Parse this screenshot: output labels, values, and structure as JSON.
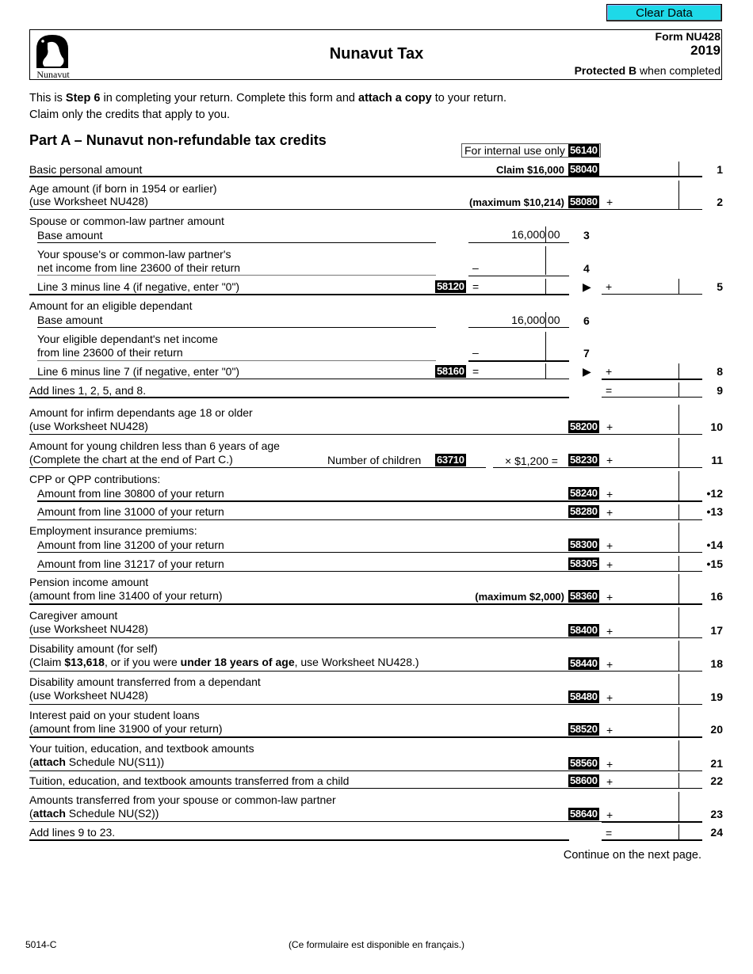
{
  "toolbar": {
    "clear_label": "Clear Data",
    "button_color": "#1ed9e8"
  },
  "header": {
    "logo_text": "Nunavut",
    "title": "Nunavut Tax",
    "form_id": "Form NU428",
    "year": "2019",
    "protected_bold": "Protected B",
    "protected_rest": " when completed"
  },
  "intro": {
    "line1": {
      "a": "This is ",
      "b": "Step 6",
      "c": " in completing your return. Complete this form and ",
      "d": "attach a copy",
      "e": " to your return."
    },
    "line2": "Claim only the credits that apply to you."
  },
  "part_a": {
    "title": "Part A – Nunavut non-refundable tax credits",
    "internal_use_label": "For internal use only",
    "internal_use_code": "56140"
  },
  "lines": {
    "l1": {
      "label": "Basic personal amount",
      "note": "Claim $16,000",
      "code": "58040",
      "num": "1"
    },
    "l2": {
      "label1": "Age amount (if born in 1954 or earlier)",
      "label2": "(use Worksheet NU428)",
      "note": "(maximum $10,214)",
      "code": "58080",
      "op": "+",
      "num": "2"
    },
    "spouse_heading": "Spouse or common-law partner amount",
    "l3": {
      "label": "Base amount",
      "value_dollars": "16,000",
      "value_cents": "00",
      "num": "3"
    },
    "l4": {
      "label1": "Your spouse's or common-law partner's",
      "label2": "net income from line 23600 of their return",
      "op": "–",
      "num": "4"
    },
    "l5": {
      "label": "Line 3 minus line 4 (if negative, enter \"0\")",
      "code": "58120",
      "op_eq": "=",
      "arrow": "▶",
      "op": "+",
      "num": "5"
    },
    "dependant_heading": "Amount for an eligible dependant",
    "l6": {
      "label": "Base amount",
      "value_dollars": "16,000",
      "value_cents": "00",
      "num": "6"
    },
    "l7": {
      "label1": "Your eligible dependant's net income",
      "label2": "from line 23600 of their return",
      "op": "–",
      "num": "7"
    },
    "l8": {
      "label": "Line 6 minus line 7 (if negative, enter \"0\")",
      "code": "58160",
      "op_eq": "=",
      "arrow": "▶",
      "op": "+",
      "num": "8"
    },
    "l9": {
      "label": "Add lines 1, 2, 5, and 8.",
      "op": "=",
      "num": "9"
    },
    "l10": {
      "label1": "Amount for infirm dependants age 18 or older",
      "label2": "(use Worksheet NU428)",
      "code": "58200",
      "op": "+",
      "num": "10"
    },
    "l11": {
      "label1": "Amount for young children less than 6 years of age",
      "label2": "(Complete the chart at the end of Part C.)",
      "children_label": "Number of children",
      "children_code": "63710",
      "multiplier": "× $1,200 =",
      "code": "58230",
      "op": "+",
      "num": "11"
    },
    "cpp_heading": "CPP or QPP contributions:",
    "l12": {
      "label": "Amount from line 30800 of your return",
      "code": "58240",
      "op": "+",
      "num": "•12"
    },
    "l13": {
      "label": "Amount from line 31000 of your return",
      "code": "58280",
      "op": "+",
      "num": "•13"
    },
    "ei_heading": "Employment insurance premiums:",
    "l14": {
      "label": "Amount from line 31200 of your return",
      "code": "58300",
      "op": "+",
      "num": "•14"
    },
    "l15": {
      "label": "Amount from line 31217 of your return",
      "code": "58305",
      "op": "+",
      "num": "•15"
    },
    "l16": {
      "label1": "Pension income amount",
      "label2": "(amount from line 31400 of your return)",
      "note": "(maximum $2,000)",
      "code": "58360",
      "op": "+",
      "num": "16"
    },
    "l17": {
      "label1": "Caregiver amount",
      "label2": "(use Worksheet NU428)",
      "code": "58400",
      "op": "+",
      "num": "17"
    },
    "l18": {
      "label1": "Disability amount (for self)",
      "label2a": "(Claim ",
      "label2b": "$13,618",
      "label2c": ", or if you were ",
      "label2d": "under 18 years of age",
      "label2e": ", use Worksheet NU428.)",
      "code": "58440",
      "op": "+",
      "num": "18"
    },
    "l19": {
      "label1": "Disability amount transferred from a dependant",
      "label2": "(use Worksheet NU428)",
      "code": "58480",
      "op": "+",
      "num": "19"
    },
    "l20": {
      "label1": "Interest paid on your student loans",
      "label2": "(amount from line 31900 of your return)",
      "code": "58520",
      "op": "+",
      "num": "20"
    },
    "l21": {
      "label1": "Your tuition, education, and textbook amounts",
      "label2a": "(",
      "label2b": "attach",
      "label2c": " Schedule NU(S11))",
      "code": "58560",
      "op": "+",
      "num": "21"
    },
    "l22": {
      "label": "Tuition, education, and textbook amounts transferred from a child",
      "code": "58600",
      "op": "+",
      "num": "22"
    },
    "l23": {
      "label1": "Amounts transferred from your spouse or common-law partner",
      "label2a": "(",
      "label2b": "attach",
      "label2c": " Schedule NU(S2))",
      "code": "58640",
      "op": "+",
      "num": "23"
    },
    "l24": {
      "label": "Add lines 9 to 23.",
      "op": "=",
      "num": "24"
    }
  },
  "continue_text": "Continue on the next page.",
  "footer": {
    "form_code": "5014-C",
    "french_note": "(Ce formulaire est disponible en français.)"
  }
}
